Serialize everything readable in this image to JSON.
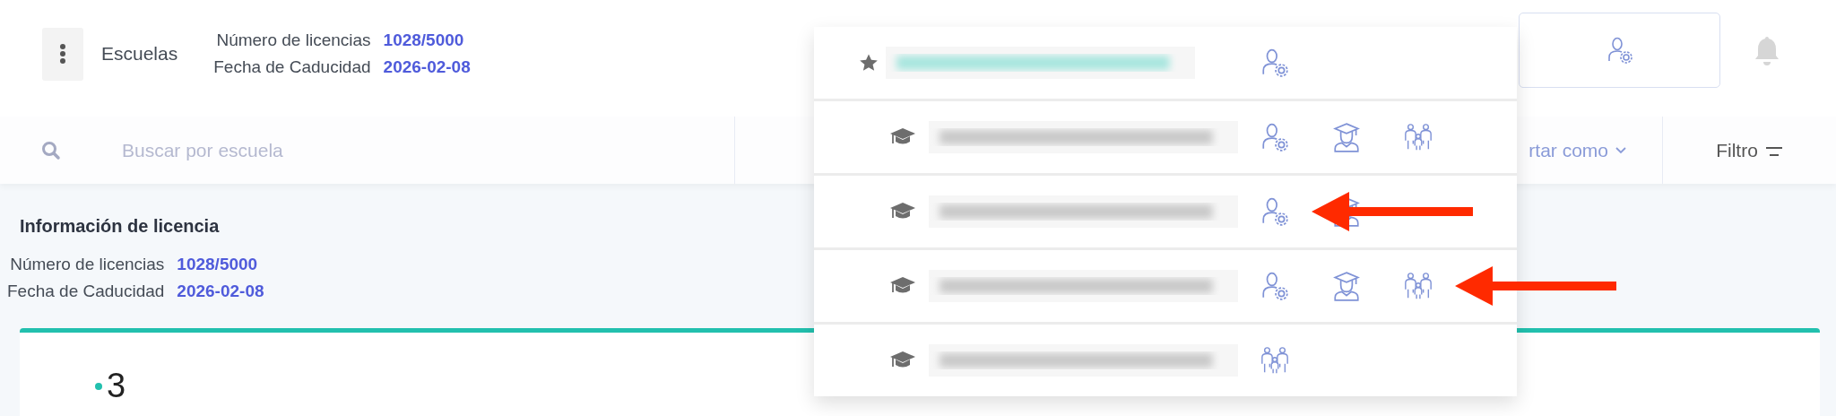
{
  "header": {
    "title": "Escuelas",
    "license": [
      {
        "label": "Número de licencias",
        "value": "1028/5000"
      },
      {
        "label": "Fecha de Caducidad",
        "value": "2026-02-08"
      }
    ]
  },
  "toolbar": {
    "search": {
      "placeholder": "Buscar por escuela"
    },
    "sort": {
      "label": "rtar como"
    },
    "filter": {
      "label": "Filtro"
    }
  },
  "license_info": {
    "title": "Información de licencia",
    "rows": [
      {
        "label": "Número de licencias",
        "value": "1028/5000"
      },
      {
        "label": "Fecha de Caducidad",
        "value": "2026-02-08"
      }
    ]
  },
  "card": {
    "count": "3"
  },
  "school_menu": {
    "rows": [
      {
        "kind": "favorite",
        "roles": [
          {
            "kind": "admin",
            "arrow": false
          }
        ]
      },
      {
        "kind": "school",
        "roles": [
          {
            "kind": "admin",
            "arrow": false
          },
          {
            "kind": "teacher",
            "arrow": false
          },
          {
            "kind": "family",
            "arrow": false
          }
        ]
      },
      {
        "kind": "school",
        "roles": [
          {
            "kind": "admin",
            "arrow": true
          },
          {
            "kind": "teacher",
            "arrow": false
          }
        ]
      },
      {
        "kind": "school",
        "roles": [
          {
            "kind": "admin",
            "arrow": false
          },
          {
            "kind": "teacher",
            "arrow": false
          },
          {
            "kind": "family",
            "arrow": true
          }
        ]
      },
      {
        "kind": "school",
        "roles": [
          {
            "kind": "family",
            "arrow": false
          }
        ]
      }
    ]
  }
}
